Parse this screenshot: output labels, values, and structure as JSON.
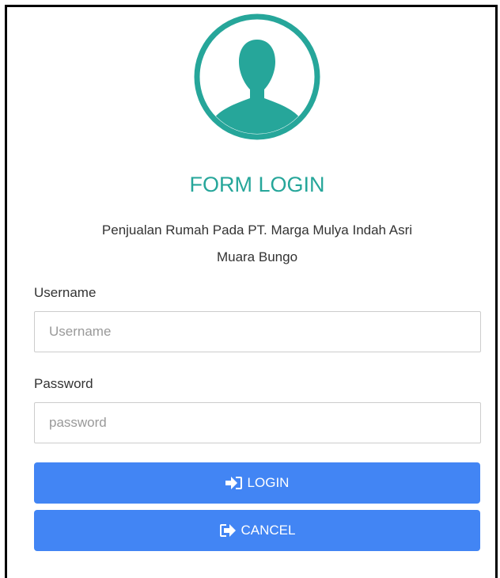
{
  "form": {
    "avatar_icon": "user-silhouette-icon",
    "title": "FORM LOGIN",
    "subtitle_line1": "Penjualan Rumah Pada PT. Marga Mulya Indah Asri",
    "subtitle_line2": "Muara Bungo",
    "username_label": "Username",
    "username_placeholder": "Username",
    "username_value": "",
    "password_label": "Password",
    "password_placeholder": "password",
    "password_value": "",
    "login_label": "LOGIN",
    "login_icon": "sign-in-icon",
    "cancel_label": "CANCEL",
    "cancel_icon": "sign-out-icon"
  },
  "colors": {
    "accent": "#26a69a",
    "button": "#4285f4",
    "border": "#cccccc"
  }
}
